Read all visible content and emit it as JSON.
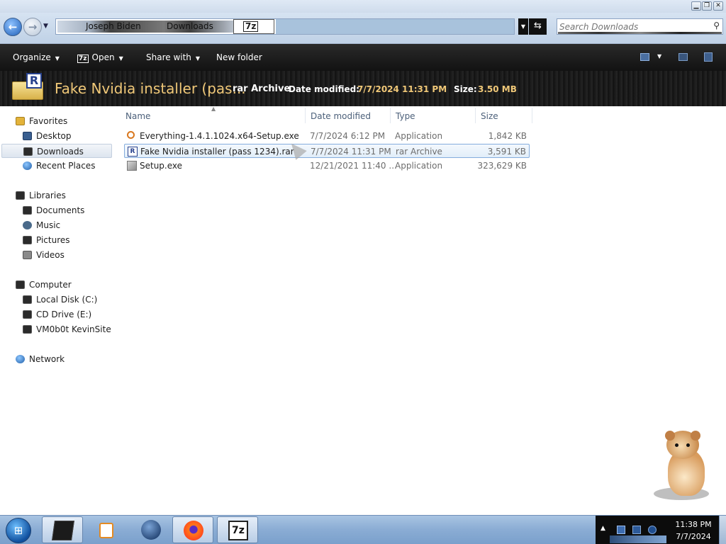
{
  "window": {
    "controls": {
      "minimize": "▁",
      "maximize": "❐",
      "close": "✕"
    }
  },
  "address": {
    "breadcrumbs": [
      "Joseph Biden",
      "Downloads"
    ],
    "tile_label": "7z",
    "search_placeholder": "Search Downloads"
  },
  "toolbar": {
    "organize": "Organize",
    "open": "Open",
    "open_icon": "7z",
    "share_with": "Share with",
    "new_folder": "New folder"
  },
  "details": {
    "icon_letter": "R",
    "name": "Fake Nvidia installer (pas...",
    "type": "rar Archive",
    "date_label": "Date modified:",
    "date_value": "7/7/2024 11:31 PM",
    "size_label": "Size:",
    "size_value": "3.50 MB"
  },
  "nav": {
    "favorites": {
      "label": "Favorites",
      "items": [
        {
          "label": "Desktop",
          "icon": "desktop-icon"
        },
        {
          "label": "Downloads",
          "icon": "downloads-icon",
          "selected": true
        },
        {
          "label": "Recent Places",
          "icon": "recent-places-icon"
        }
      ]
    },
    "libraries": {
      "label": "Libraries",
      "items": [
        {
          "label": "Documents",
          "icon": "documents-icon"
        },
        {
          "label": "Music",
          "icon": "music-icon"
        },
        {
          "label": "Pictures",
          "icon": "pictures-icon"
        },
        {
          "label": "Videos",
          "icon": "videos-icon"
        }
      ]
    },
    "computer": {
      "label": "Computer",
      "items": [
        {
          "label": "Local Disk (C:)",
          "icon": "local-disk-icon"
        },
        {
          "label": "CD Drive (E:)",
          "icon": "cd-drive-icon"
        },
        {
          "label": "VM0b0t KevinSite",
          "icon": "network-drive-icon"
        }
      ]
    },
    "network": {
      "label": "Network"
    }
  },
  "files": {
    "columns": {
      "name": "Name",
      "date": "Date modified",
      "type": "Type",
      "size": "Size"
    },
    "rows": [
      {
        "name": "Everything-1.4.1.1024.x64-Setup.exe",
        "date": "7/7/2024 6:12 PM",
        "type": "Application",
        "size": "1,842 KB",
        "icon": "search-app-icon"
      },
      {
        "name": "Fake Nvidia installer (pass 1234).rar",
        "date": "7/7/2024 11:31 PM",
        "type": "rar Archive",
        "size": "3,591 KB",
        "icon": "rar-file-icon",
        "icon_letter": "R",
        "selected": true
      },
      {
        "name": "Setup.exe",
        "date": "12/21/2021 11:40 ...",
        "type": "Application",
        "size": "323,629 KB",
        "icon": "setup-file-icon"
      }
    ]
  },
  "taskbar": {
    "pinned": [
      "explorer-icon",
      "media-player-icon",
      "globe-icon",
      "firefox-icon",
      "7zip-icon"
    ],
    "sevenzip_label": "7z",
    "clock_time": "11:38 PM",
    "clock_date": "7/7/2024"
  }
}
